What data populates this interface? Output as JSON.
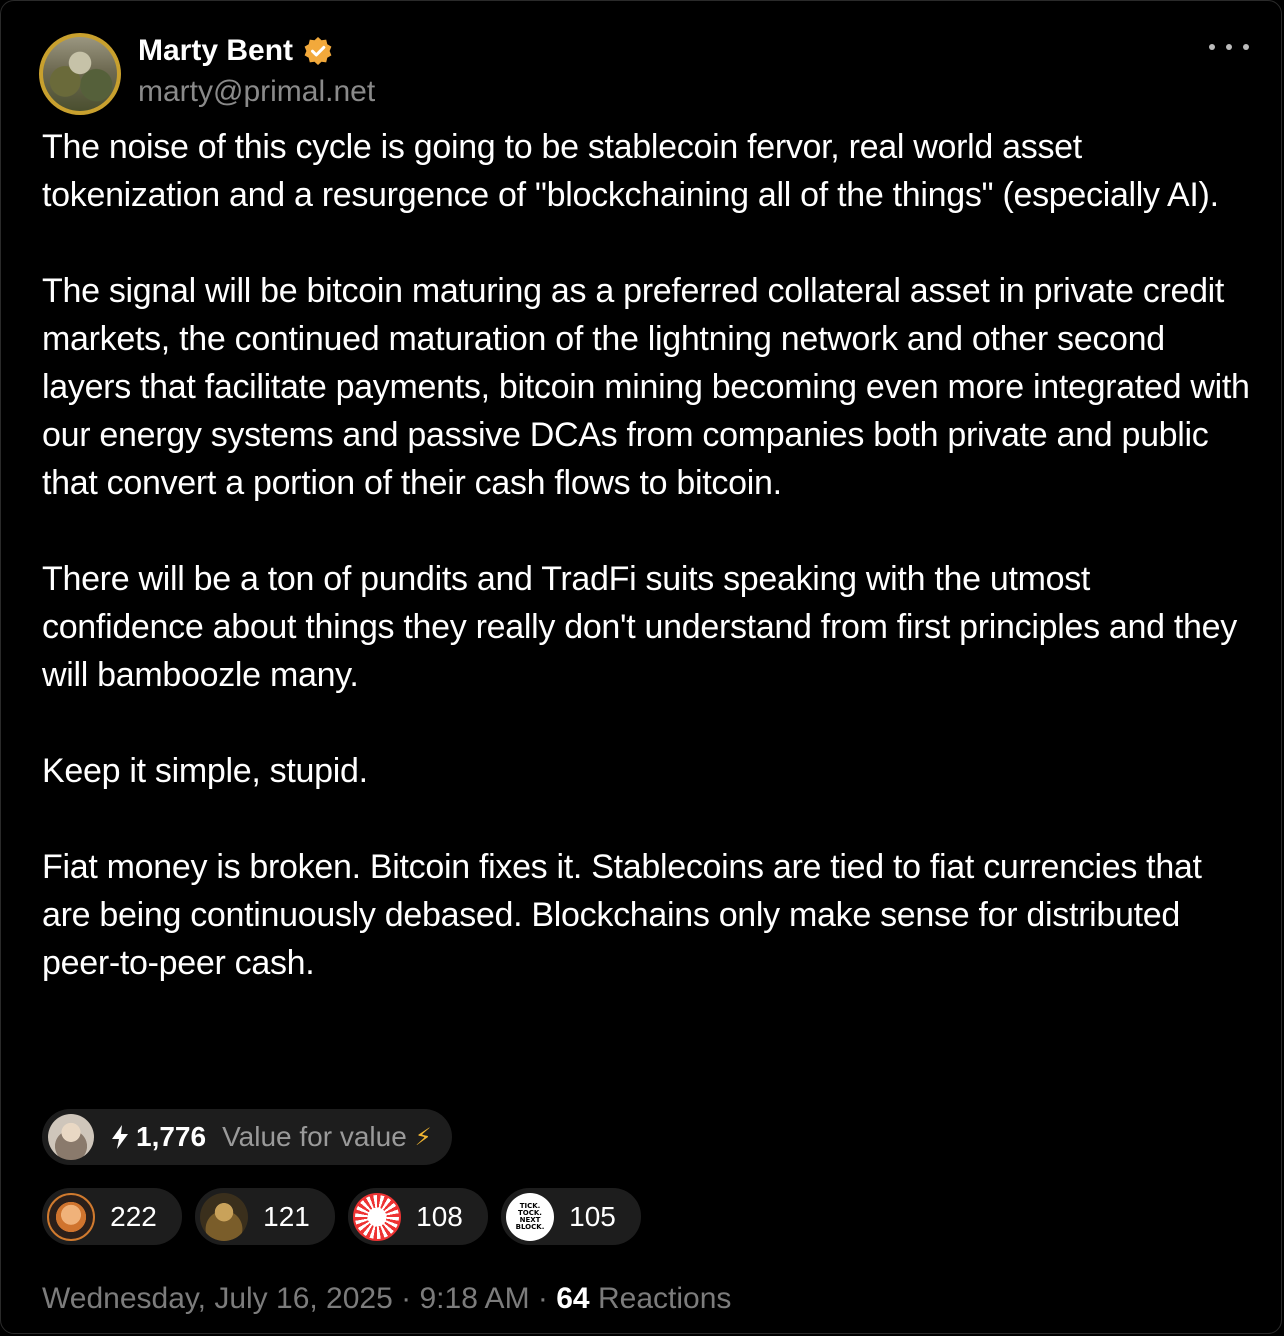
{
  "post": {
    "author_name": "Marty Bent",
    "author_handle": "marty@primal.net",
    "verified_icon": "verified-badge-icon",
    "paragraphs": [
      "The noise of this cycle is going to be stablecoin fervor, real world asset tokenization and a resurgence of \"blockchaining all of the things\" (especially AI).",
      "The signal will be bitcoin maturing as a preferred collateral asset in private credit markets, the continued maturation of the lightning network and other second layers that facilitate payments, bitcoin mining becoming even more integrated with our energy systems and passive DCAs from companies both private and public that convert a portion of their cash flows to bitcoin.",
      "There will be a ton of pundits and TradFi suits speaking with the utmost confidence about things they really don't understand from first principles and they will bamboozle many.",
      "Keep it simple, stupid.",
      "Fiat money is broken. Bitcoin fixes it. Stablecoins are tied to fiat currencies that are being continuously debased. Blockchains only make sense for distributed peer-to-peer cash."
    ]
  },
  "top_zap": {
    "amount": "1,776",
    "message": "Value for value",
    "message_emoji": "⚡"
  },
  "reactions": [
    {
      "count": "222"
    },
    {
      "count": "121"
    },
    {
      "count": "108"
    },
    {
      "count": "105",
      "avatar_text": "TICK. TOCK. NEXT BLOCK."
    }
  ],
  "footer": {
    "date": "Wednesday, July 16, 2025",
    "separator": "·",
    "time": "9:18 AM",
    "reaction_count": "64",
    "reaction_label": "Reactions"
  },
  "colors": {
    "background": "#000000",
    "text": "#ffffff",
    "muted": "#7c7c7c",
    "pill": "#1d1d1d",
    "verified": "#f2a93b"
  }
}
